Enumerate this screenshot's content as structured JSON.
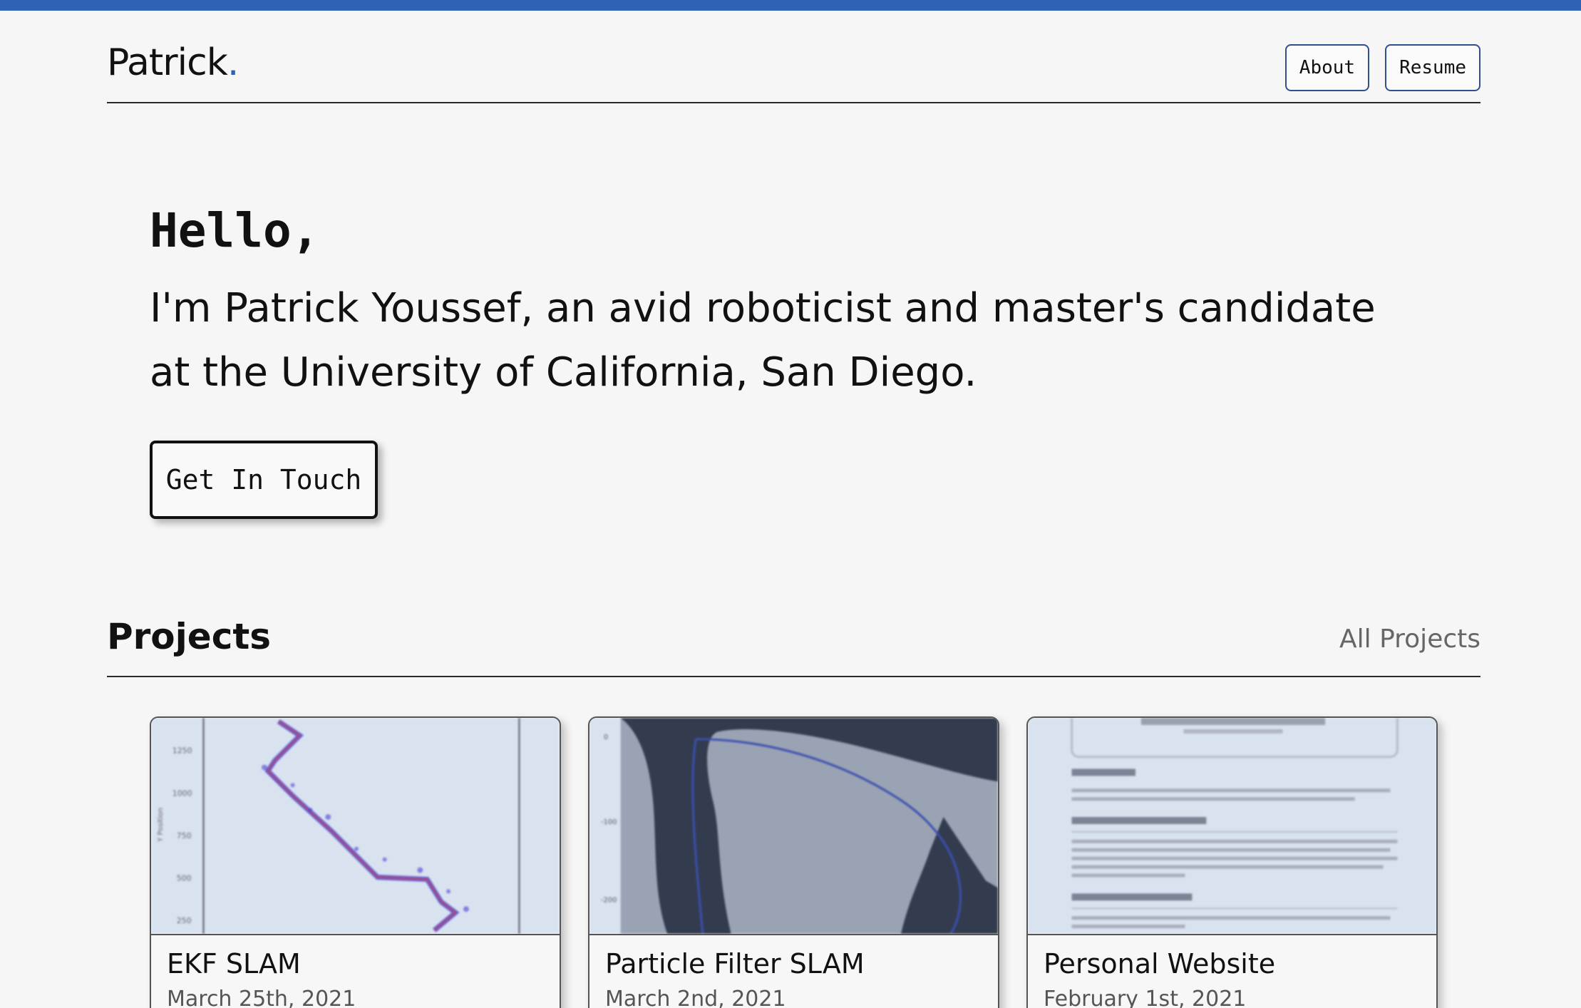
{
  "colors": {
    "accent": "#2f62b4",
    "background": "#f6f6f6",
    "text": "#111111",
    "muted": "#666666"
  },
  "header": {
    "brand_name": "Patrick",
    "brand_dot": ".",
    "nav": [
      {
        "label": "About"
      },
      {
        "label": "Resume"
      }
    ]
  },
  "hero": {
    "greeting": "Hello,",
    "intro": "I'm Patrick Youssef, an avid roboticist and master's candidate at the University of California, San Diego.",
    "cta_label": "Get In Touch"
  },
  "projects": {
    "title": "Projects",
    "all_link": "All Projects",
    "cards": [
      {
        "title": "EKF SLAM",
        "date": "March 25th, 2021",
        "thumbnail": "trajectory-plot"
      },
      {
        "title": "Particle Filter SLAM",
        "date": "March 2nd, 2021",
        "thumbnail": "occupancy-map"
      },
      {
        "title": "Personal Website",
        "date": "February 1st, 2021",
        "thumbnail": "blog-post-preview"
      }
    ]
  }
}
